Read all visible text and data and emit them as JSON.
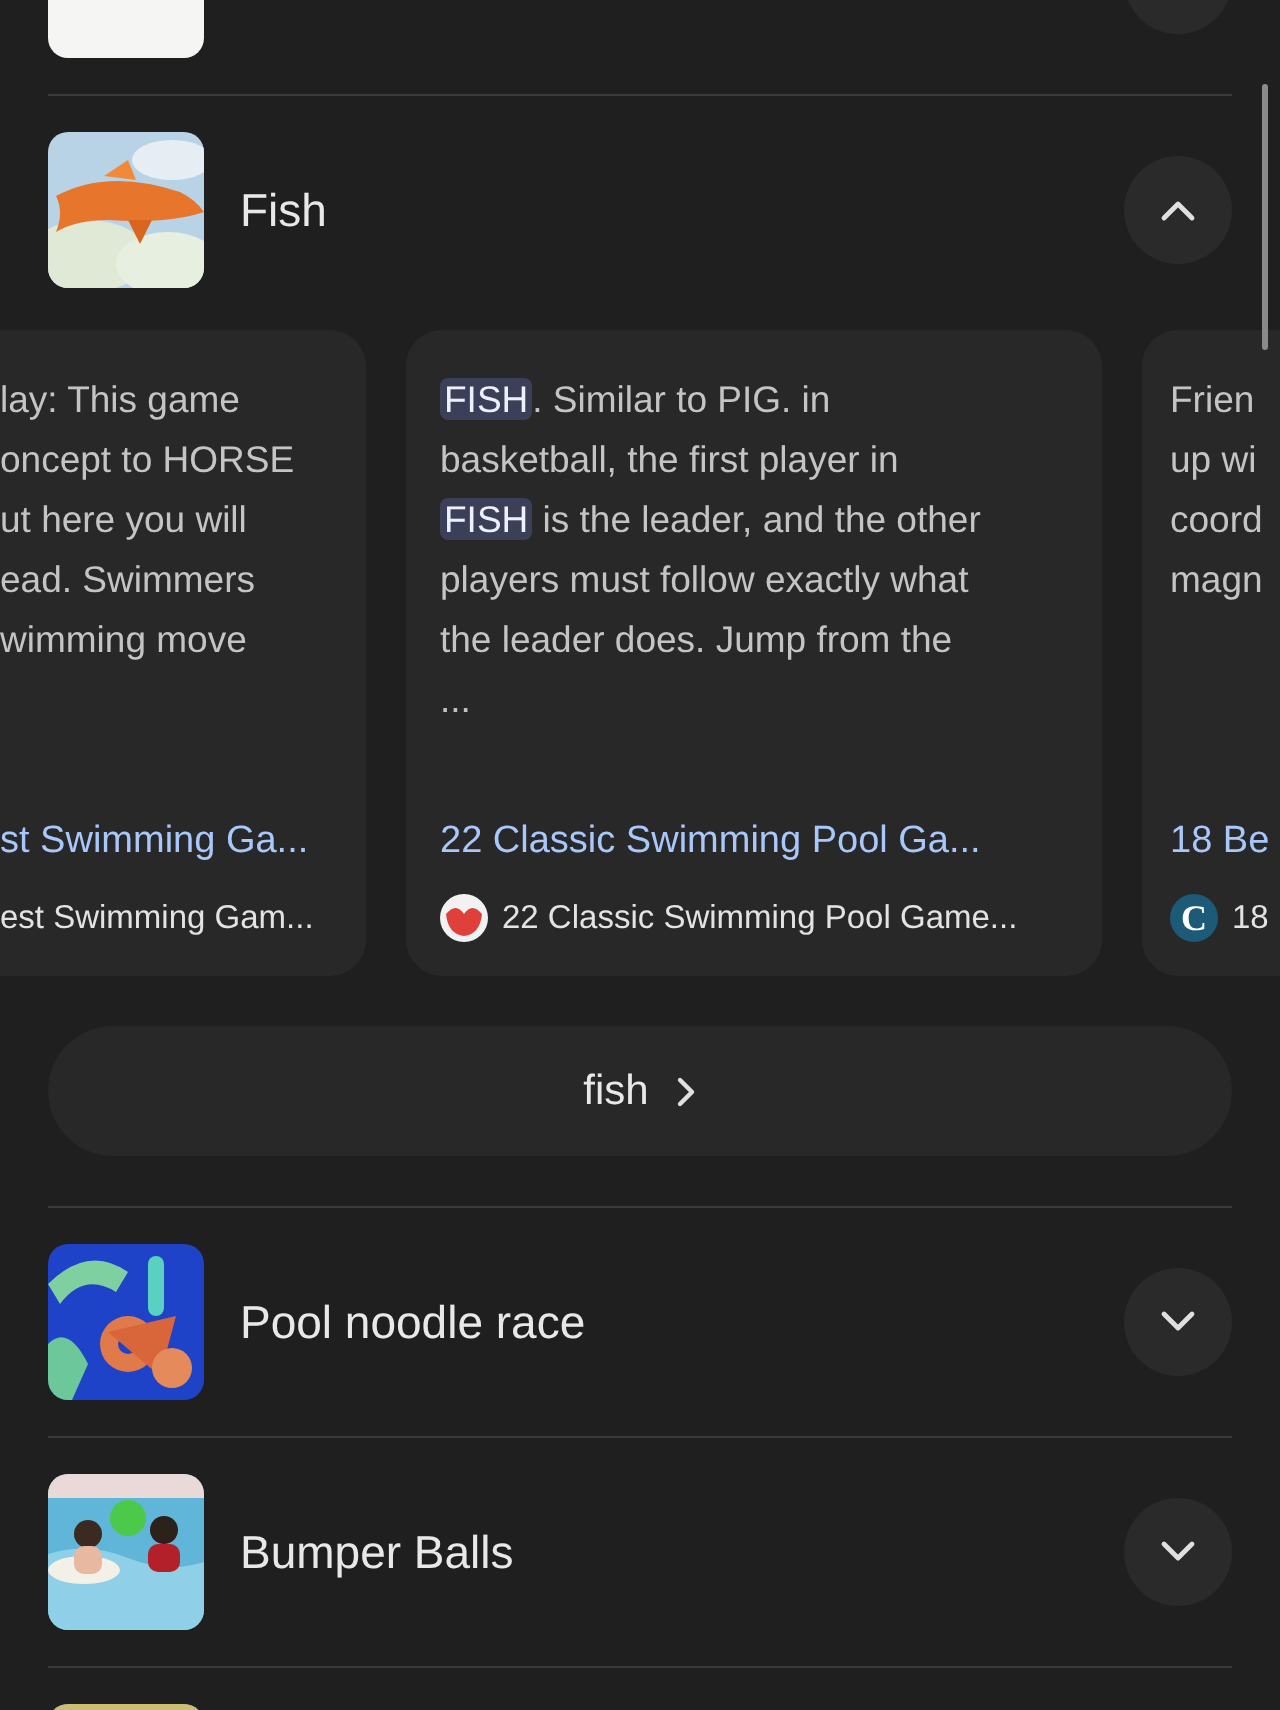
{
  "rows": [
    {},
    {
      "title": "Fish",
      "expanded": true,
      "cards": [
        {
          "lines": [
            [
              {
                "text": "lay: This game",
                "highlight": false
              }
            ],
            [
              {
                "text": "oncept to HORSE",
                "highlight": false
              }
            ],
            [
              {
                "text": "ut here you will",
                "highlight": false
              }
            ],
            [
              {
                "text": "ead. Swimmers",
                "highlight": false
              }
            ],
            [
              {
                "text": "wimming move",
                "highlight": false
              }
            ]
          ],
          "title": "st Swimming Ga...",
          "source": "est Swimming Gam..."
        },
        {
          "lines": [
            [
              {
                "text": "FISH",
                "highlight": true
              },
              {
                "text": ". Similar to PIG. in",
                "highlight": false
              }
            ],
            [
              {
                "text": "basketball, the first player in",
                "highlight": false
              }
            ],
            [
              {
                "text": "FISH",
                "highlight": true
              },
              {
                "text": " is the leader, and the other",
                "highlight": false
              }
            ],
            [
              {
                "text": "players must follow exactly what",
                "highlight": false
              }
            ],
            [
              {
                "text": "the leader does. Jump from the",
                "highlight": false
              }
            ],
            [
              {
                "text": "...",
                "highlight": false
              }
            ]
          ],
          "title": "22 Classic Swimming Pool Ga...",
          "source": "22 Classic Swimming Pool Game...",
          "favicon": {
            "kind": "ball"
          }
        },
        {
          "lines": [
            [
              {
                "text": "Frien",
                "highlight": false
              }
            ],
            [
              {
                "text": "up wi",
                "highlight": false
              }
            ],
            [
              {
                "text": "coord",
                "highlight": false
              }
            ],
            [
              {
                "text": "magn",
                "highlight": false
              }
            ]
          ],
          "title": "18 Be",
          "source": "18",
          "favicon": {
            "kind": "letter",
            "text": "C"
          }
        }
      ],
      "more_button": "fish"
    },
    {
      "title": "Pool noodle race",
      "expanded": false
    },
    {
      "title": "Bumper Balls",
      "expanded": false
    },
    {}
  ]
}
